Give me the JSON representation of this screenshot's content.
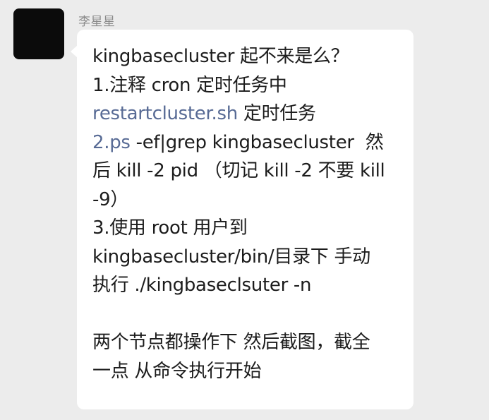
{
  "sender": {
    "name": "李星星"
  },
  "message": {
    "lines": [
      {
        "text": "kingbasecluster 起不来是么？"
      },
      {
        "text": "1.注释 cron 定时任务中"
      },
      {
        "link": "restartcluster.sh",
        "text": " 定时任务"
      },
      {
        "link": "2.ps",
        "text": " -ef|grep kingbasecluster  然"
      },
      {
        "text": "后 kill -2 pid （切记 kill -2 不要 kill"
      },
      {
        "text": "-9）"
      },
      {
        "text": "3.使用 root 用户到"
      },
      {
        "text": "kingbasecluster/bin/目录下 手动"
      },
      {
        "text": "执行 ./kingbaseclsuter -n"
      },
      {
        "text": ""
      },
      {
        "text": "两个节点都操作下 然后截图，截全"
      },
      {
        "text": "一点 从命令执行开始"
      }
    ]
  },
  "colors": {
    "background": "#ececec",
    "bubble": "#ffffff",
    "link": "#586b95",
    "sender_name": "#8a8a8a"
  }
}
